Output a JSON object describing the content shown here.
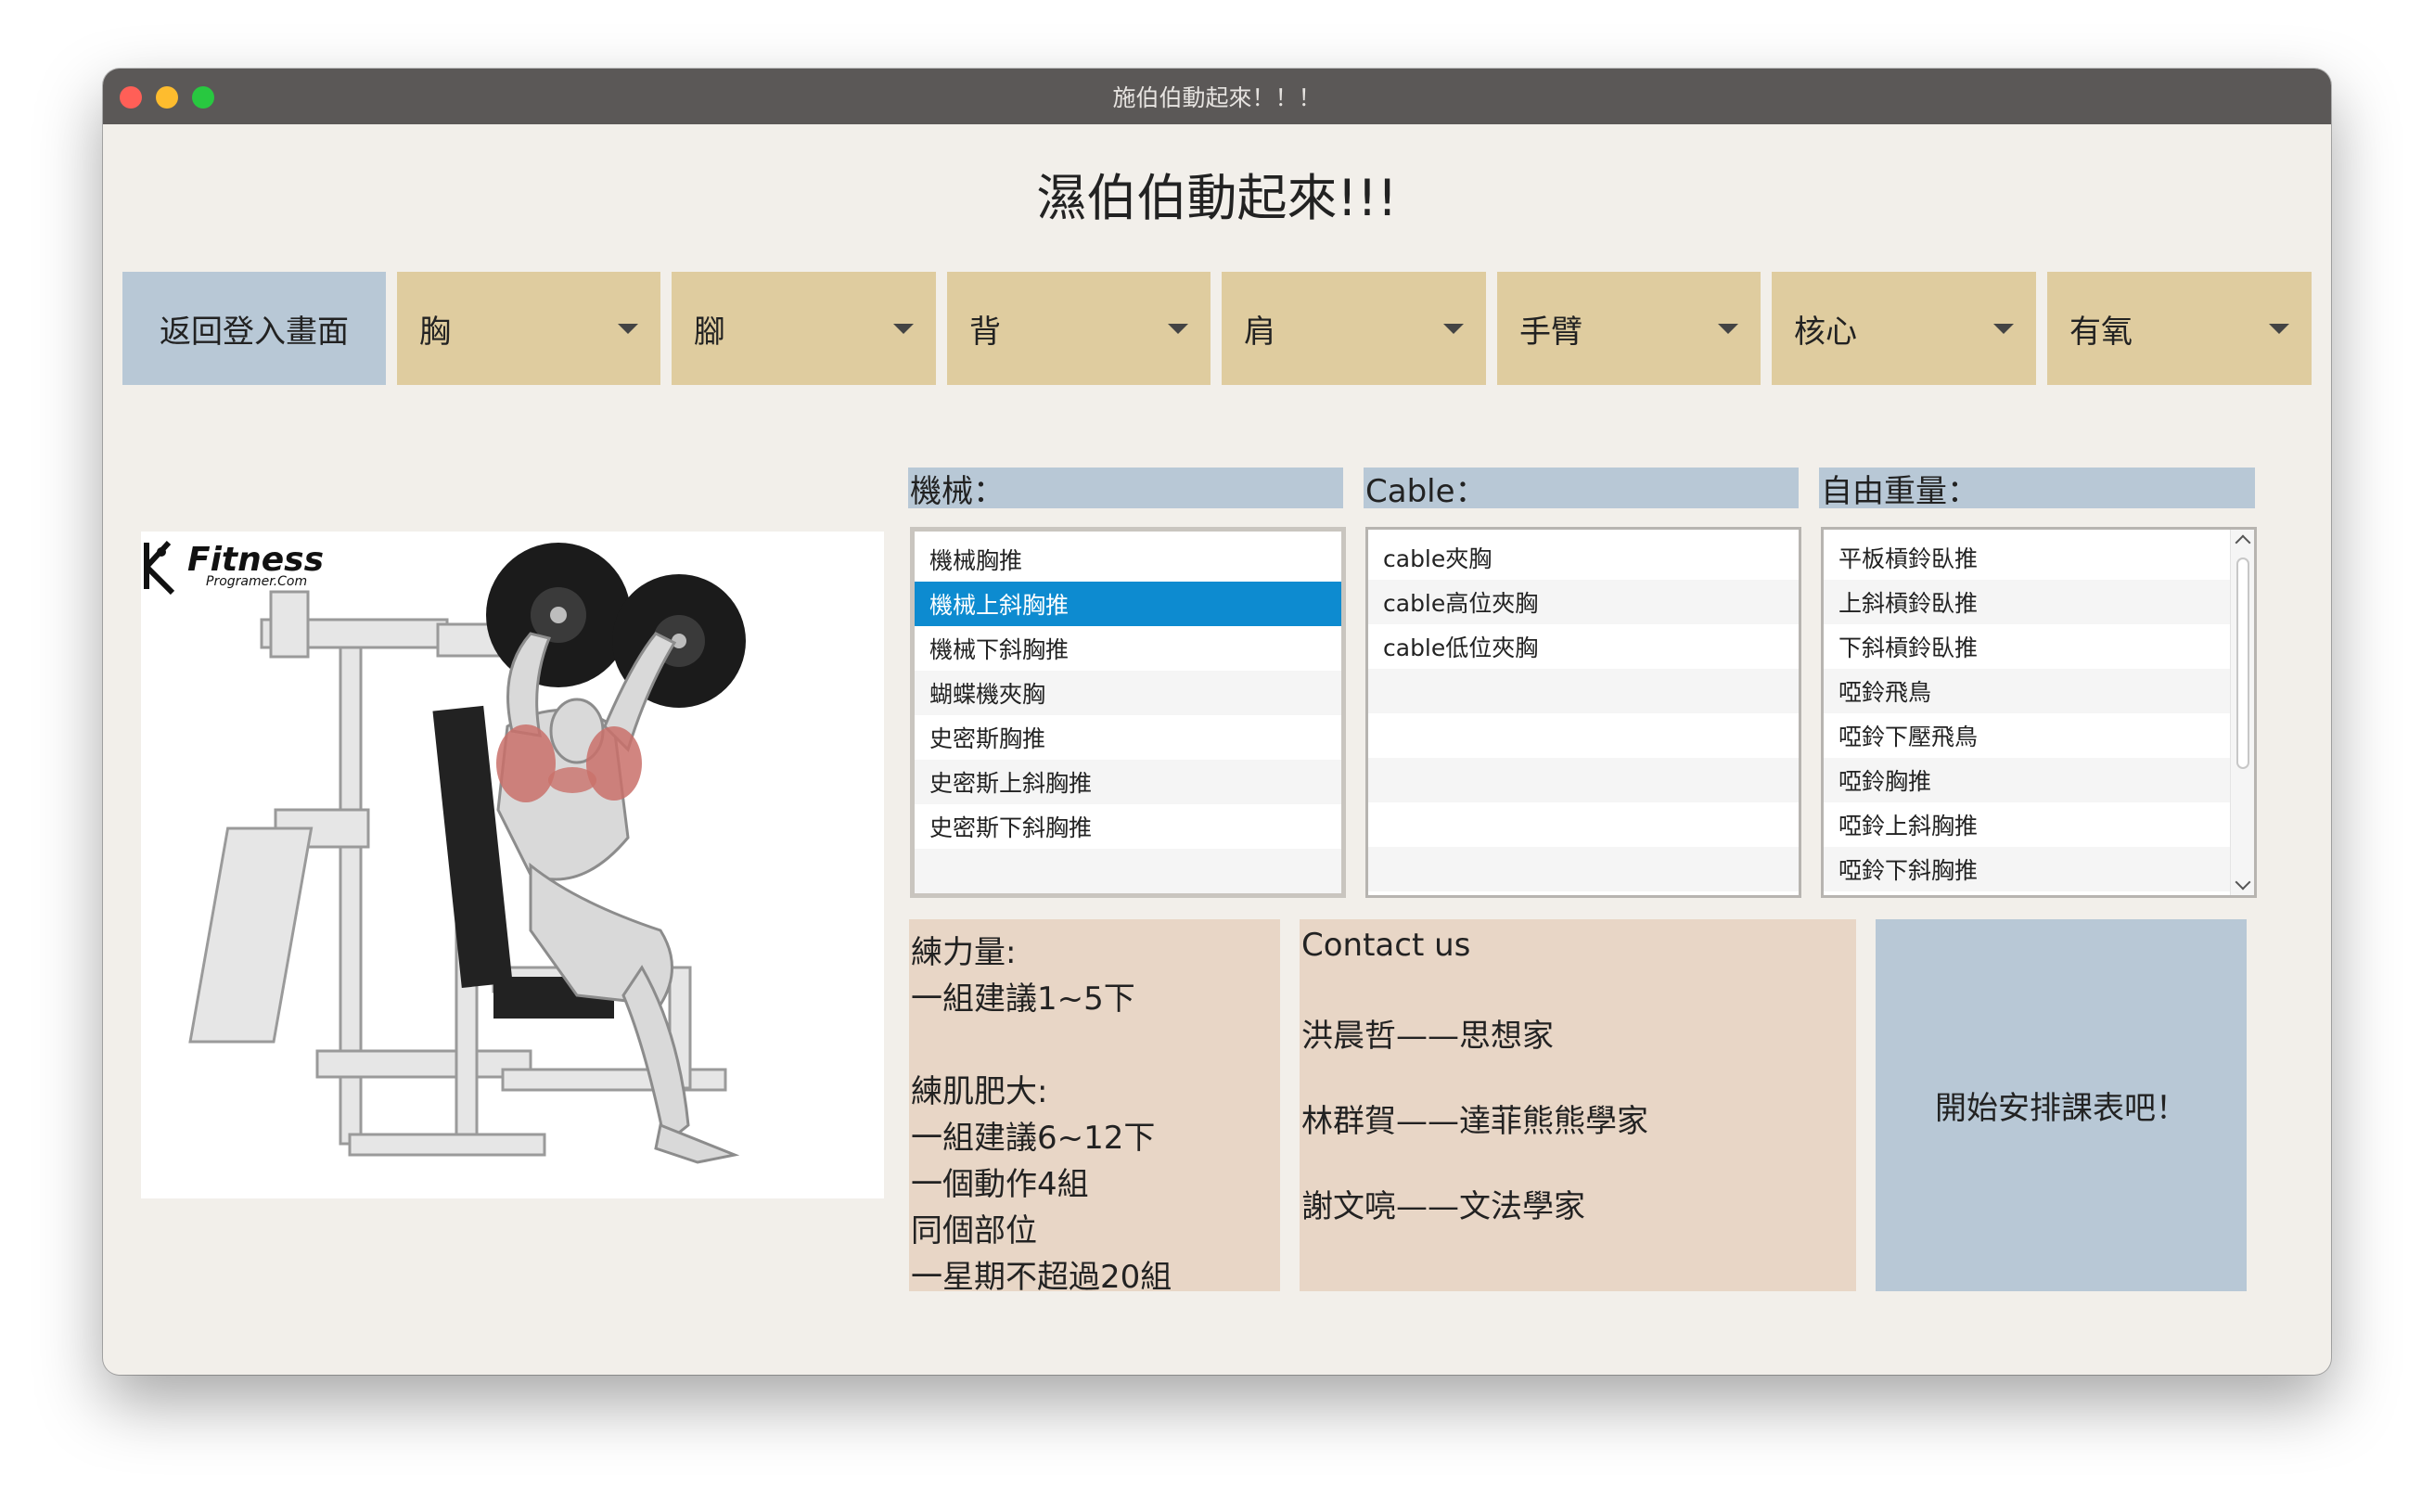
{
  "window": {
    "title": "施伯伯動起來！！！"
  },
  "app_title": "濕伯伯動起來!!!",
  "nav": {
    "home_label": "返回登入畫面",
    "dropdowns": [
      "胸",
      "腳",
      "背",
      "肩",
      "手臂",
      "核心",
      "有氧"
    ]
  },
  "photo": {
    "brand": "Fitness",
    "brand_sub": "Programer.Com"
  },
  "categories": {
    "machine": {
      "label": "機械：",
      "items": [
        "機械胸推",
        "機械上斜胸推",
        "機械下斜胸推",
        "蝴蝶機夾胸",
        "史密斯胸推",
        "史密斯上斜胸推",
        "史密斯下斜胸推"
      ],
      "selected_index": 1
    },
    "cable": {
      "label": "Cable：",
      "items": [
        "cable夾胸",
        "cable高位夾胸",
        "cable低位夾胸"
      ]
    },
    "free": {
      "label": "自由重量：",
      "items": [
        "平板槓鈴臥推",
        "上斜槓鈴臥推",
        "下斜槓鈴臥推",
        "啞鈴飛鳥",
        "啞鈴下壓飛鳥",
        "啞鈴胸推",
        "啞鈴上斜胸推",
        "啞鈴下斜胸推"
      ]
    }
  },
  "advice": {
    "lines": [
      "練力量:",
      "一組建議1~5下",
      "",
      "練肌肥大:",
      "一組建議6~12下",
      "一個動作4組",
      "同個部位",
      "一星期不超過20組"
    ]
  },
  "contact": {
    "title": "Contact us",
    "people": [
      "洪晨哲——思想家",
      "林群賀——達菲熊熊學家",
      "謝文喨——文法學家"
    ]
  },
  "start_button": "開始安排課表吧！"
}
